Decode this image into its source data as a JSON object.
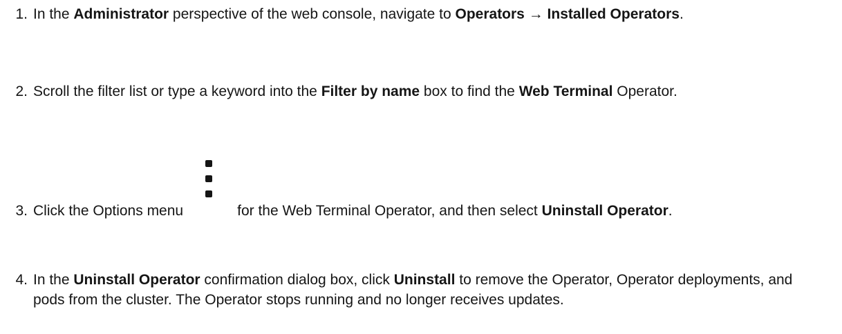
{
  "steps": [
    {
      "number": "1.",
      "parts": [
        {
          "text": "In the ",
          "bold": false
        },
        {
          "text": "Administrator",
          "bold": true
        },
        {
          "text": " perspective of the web console, navigate to ",
          "bold": false
        },
        {
          "text": "Operators → Installed Operators",
          "bold": true
        },
        {
          "text": ".",
          "bold": false
        }
      ]
    },
    {
      "number": "2.",
      "parts": [
        {
          "text": "Scroll the filter list or type a keyword into the ",
          "bold": false
        },
        {
          "text": "Filter by name",
          "bold": true
        },
        {
          "text": " box to find the ",
          "bold": false
        },
        {
          "text": "Web Terminal",
          "bold": true
        },
        {
          "text": " Operator.",
          "bold": false
        }
      ]
    },
    {
      "number": "3.",
      "before_icon": "Click the Options menu",
      "icon": "kebab-vertical-icon",
      "after_icon": "for the Web Terminal Operator, and then select ",
      "bold_end": "Uninstall Operator",
      "end": "."
    },
    {
      "number": "4.",
      "parts": [
        {
          "text": "In the ",
          "bold": false
        },
        {
          "text": "Uninstall Operator",
          "bold": true
        },
        {
          "text": " confirmation dialog box, click ",
          "bold": false
        },
        {
          "text": "Uninstall",
          "bold": true
        },
        {
          "text": " to remove the Operator, Operator deployments, and pods from the cluster. The Operator stops running and no longer receives updates.",
          "bold": false
        }
      ]
    }
  ]
}
